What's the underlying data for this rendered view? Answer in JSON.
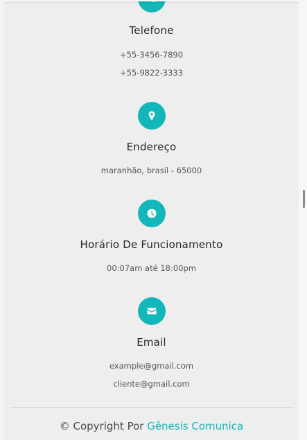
{
  "colors": {
    "accent": "#14b7b9",
    "background": "#efeeee",
    "title": "#262626",
    "text": "#555555"
  },
  "telefone": {
    "icon": "phone-icon",
    "title": "Telefone",
    "lines": [
      "+55-3456-7890",
      "+55-9822-3333"
    ]
  },
  "endereco": {
    "icon": "map-marker-icon",
    "title": "Endereço",
    "lines": [
      "maranhão, brasil - 65000"
    ]
  },
  "horario": {
    "icon": "clock-icon",
    "title": "Horário De Funcionamento",
    "lines": [
      "00:07am até 18:00pm"
    ]
  },
  "email": {
    "icon": "envelope-icon",
    "title": "Email",
    "lines": [
      "example@gmail.com",
      "cliente@gmail.com"
    ]
  },
  "footer": {
    "copyright_prefix": "© Copyright Por",
    "brand": "Gênesis Comunica"
  }
}
